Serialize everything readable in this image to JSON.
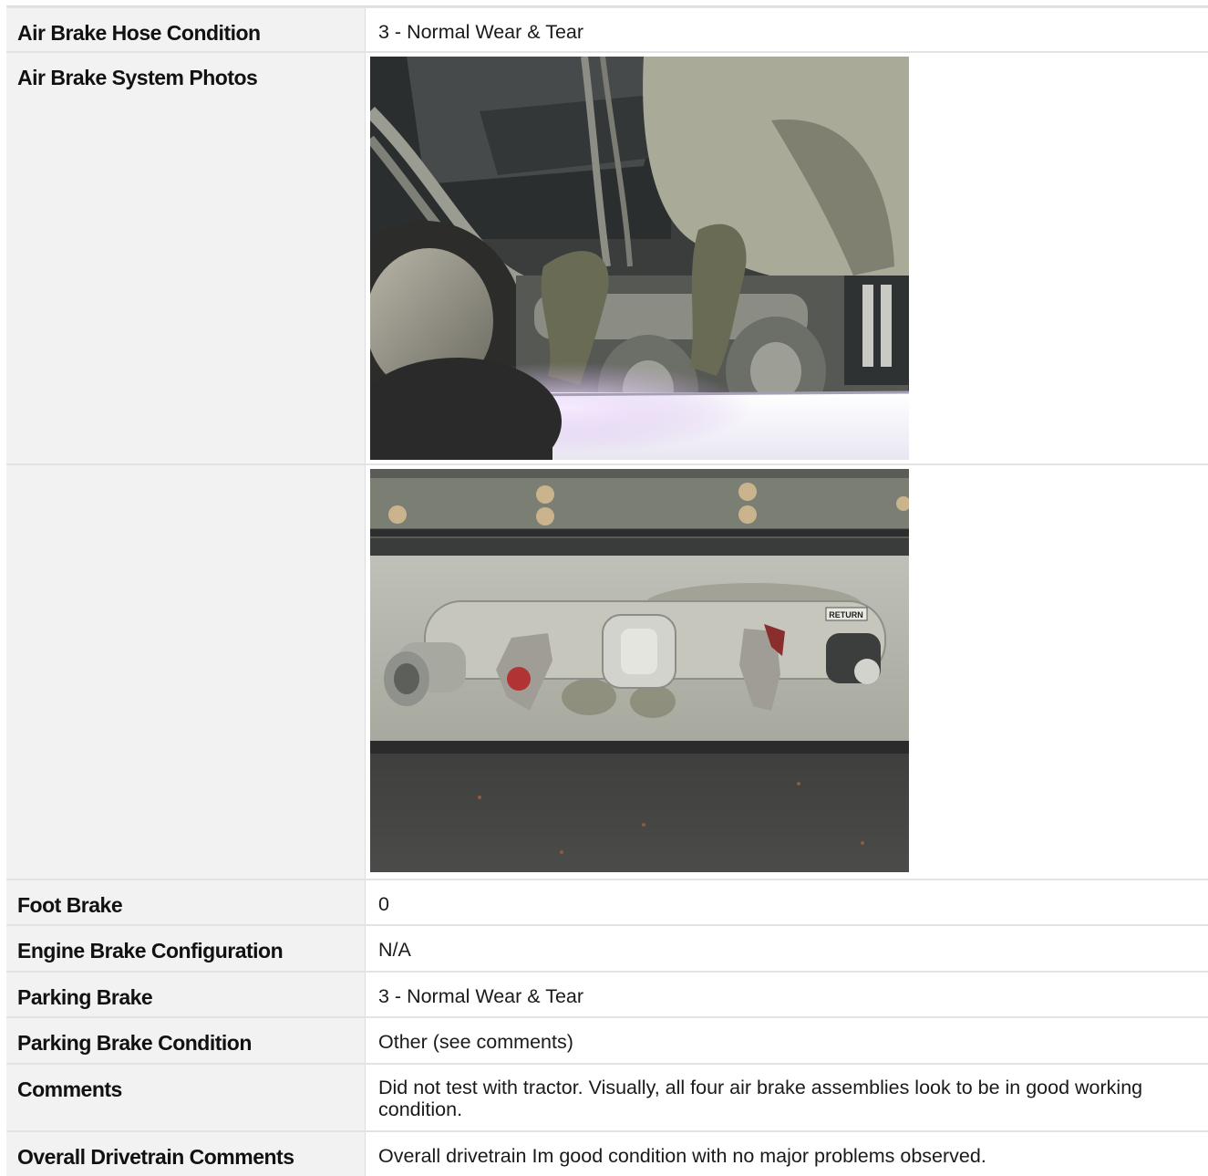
{
  "rows": [
    {
      "label": "Air Brake Hose Condition",
      "value": "3 - Normal Wear & Tear"
    },
    {
      "label": "Air Brake System Photos",
      "photo": "undercarriage-air-brake-chambers"
    },
    {
      "label": "",
      "photo": "glad-hands-air-connection-panel"
    },
    {
      "label": "Foot Brake",
      "value": "0"
    },
    {
      "label": "Engine Brake Configuration",
      "value": "N/A"
    },
    {
      "label": "Parking Brake",
      "value": "3 - Normal Wear & Tear"
    },
    {
      "label": "Parking Brake Condition",
      "value": "Other (see comments)"
    },
    {
      "label": "Comments",
      "value": "Did not test with tractor. Visually, all four air brake assemblies look to be in good working condition."
    },
    {
      "label": "Overall Drivetrain Comments",
      "value": "Overall drivetrain Im good condition with no major problems observed."
    }
  ],
  "photo_text": {
    "return_label": "RETURN"
  }
}
